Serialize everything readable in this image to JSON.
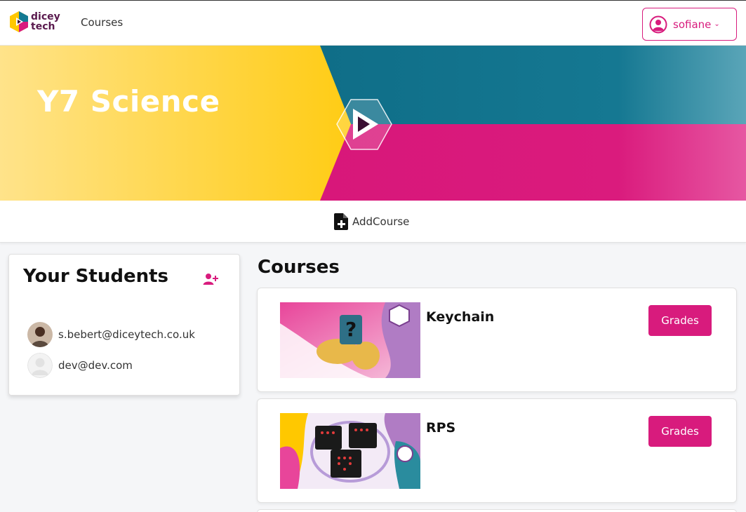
{
  "brand": {
    "line1": "dicey",
    "line2": "tech"
  },
  "nav": {
    "courses_link": "Courses"
  },
  "user": {
    "name": "sofiane"
  },
  "hero": {
    "title": "Y7 Science"
  },
  "actions": {
    "add_course": "AddCourse"
  },
  "students": {
    "title": "Your Students",
    "items": [
      {
        "email": "s.bebert@diceytech.co.uk"
      },
      {
        "email": "dev@dev.com"
      }
    ]
  },
  "courses": {
    "title": "Courses",
    "items": [
      {
        "name": "Keychain",
        "button": "Grades"
      },
      {
        "name": "RPS",
        "button": "Grades"
      }
    ]
  },
  "colors": {
    "accent": "#d81b7d",
    "yellow": "#ffc800",
    "teal": "#137a93",
    "dark": "#5a1a4e"
  }
}
